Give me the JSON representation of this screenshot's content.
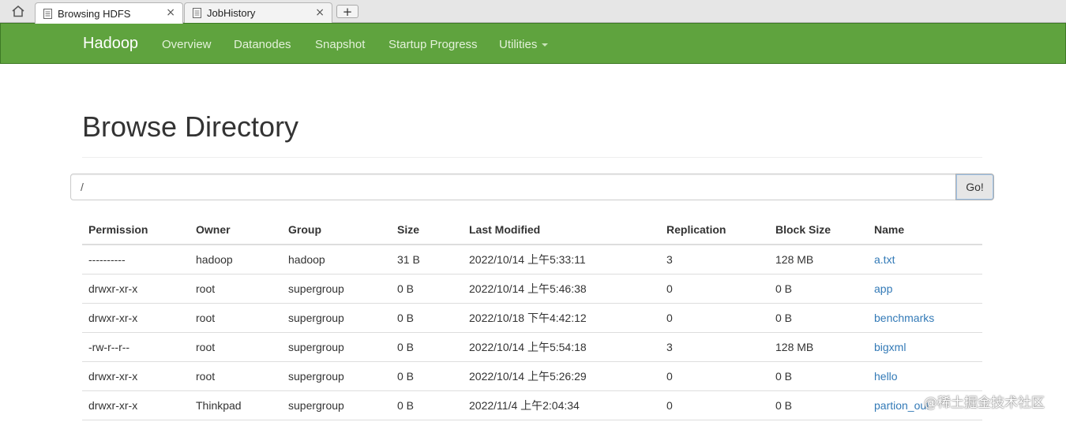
{
  "browser": {
    "tabs": [
      {
        "title": "Browsing HDFS",
        "active": true,
        "close": "×"
      },
      {
        "title": "JobHistory",
        "active": false,
        "close": "×"
      }
    ],
    "new_tab": "+"
  },
  "navbar": {
    "brand": "Hadoop",
    "items": [
      "Overview",
      "Datanodes",
      "Snapshot",
      "Startup Progress",
      "Utilities"
    ],
    "color": "#5fa33e"
  },
  "main": {
    "title": "Browse Directory",
    "path_value": "/",
    "go_label": "Go!"
  },
  "table": {
    "headers": [
      "Permission",
      "Owner",
      "Group",
      "Size",
      "Last Modified",
      "Replication",
      "Block Size",
      "Name"
    ],
    "rows": [
      [
        "----------",
        "hadoop",
        "hadoop",
        "31 B",
        "2022/10/14 上午5:33:11",
        "3",
        "128 MB",
        "a.txt"
      ],
      [
        "drwxr-xr-x",
        "root",
        "supergroup",
        "0 B",
        "2022/10/14 上午5:46:38",
        "0",
        "0 B",
        "app"
      ],
      [
        "drwxr-xr-x",
        "root",
        "supergroup",
        "0 B",
        "2022/10/18 下午4:42:12",
        "0",
        "0 B",
        "benchmarks"
      ],
      [
        "-rw-r--r--",
        "root",
        "supergroup",
        "0 B",
        "2022/10/14 上午5:54:18",
        "3",
        "128 MB",
        "bigxml"
      ],
      [
        "drwxr-xr-x",
        "root",
        "supergroup",
        "0 B",
        "2022/10/14 上午5:26:29",
        "0",
        "0 B",
        "hello"
      ],
      [
        "drwxr-xr-x",
        "Thinkpad",
        "supergroup",
        "0 B",
        "2022/11/4 上午2:04:34",
        "0",
        "0 B",
        "partion_out"
      ]
    ],
    "link_color": "#337ab7"
  },
  "watermark": "@稀土掘金技术社区"
}
